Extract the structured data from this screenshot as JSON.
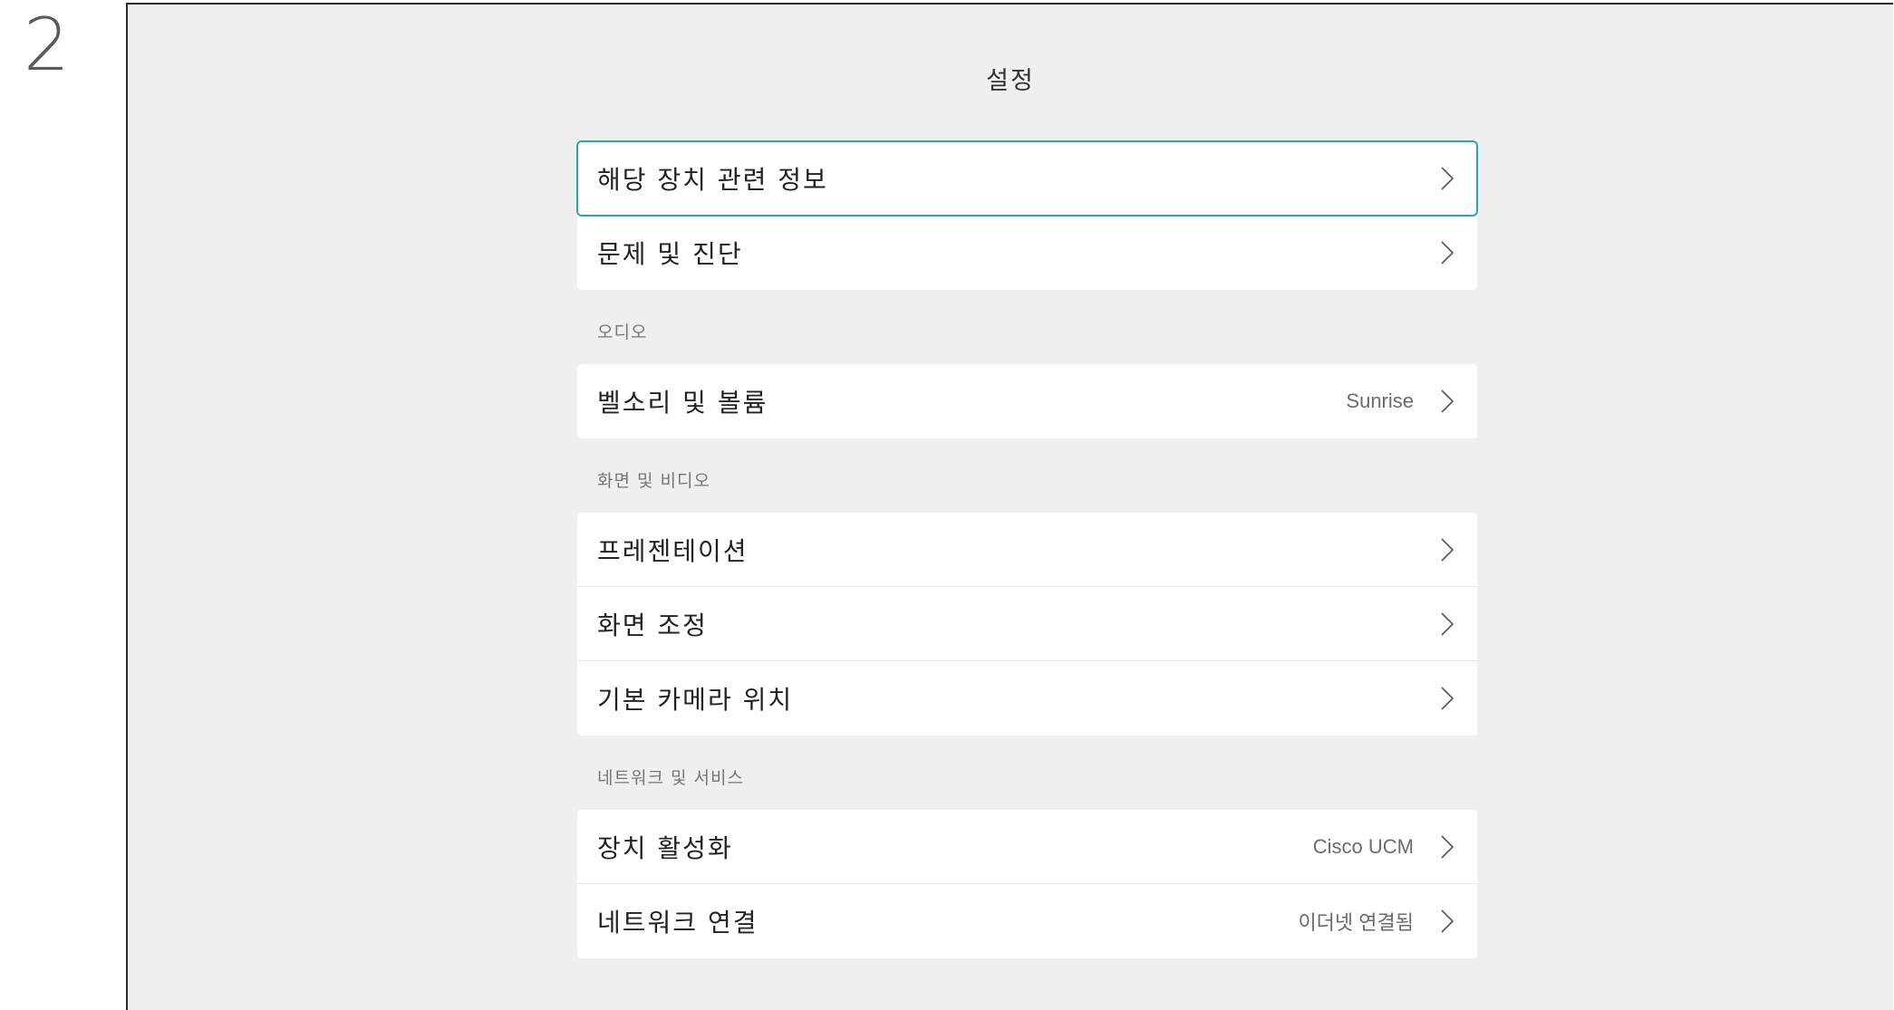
{
  "step": "2",
  "screen": {
    "title": "설정"
  },
  "groups": [
    {
      "header": "",
      "items": [
        {
          "label": "해당 장치 관련 정보",
          "value": "",
          "focused": true
        },
        {
          "label": "문제 및 진단",
          "value": ""
        }
      ]
    },
    {
      "header": "오디오",
      "items": [
        {
          "label": "벨소리 및 볼륨",
          "value": "Sunrise"
        }
      ]
    },
    {
      "header": "화면 및 비디오",
      "items": [
        {
          "label": "프레젠테이션",
          "value": ""
        },
        {
          "label": "화면 조정",
          "value": ""
        },
        {
          "label": "기본 카메라 위치",
          "value": ""
        }
      ]
    },
    {
      "header": "네트워크 및 서비스",
      "items": [
        {
          "label": "장치 활성화",
          "value": "Cisco UCM"
        },
        {
          "label": "네트워크 연결",
          "value": "이더넷 연결됨"
        }
      ]
    }
  ],
  "colors": {
    "background": "#efefef",
    "card": "#ffffff",
    "focus": "#2aa6b0",
    "text": "#222222",
    "muted": "#777777"
  },
  "icons": {
    "row_arrow": "chevron-right-icon"
  }
}
